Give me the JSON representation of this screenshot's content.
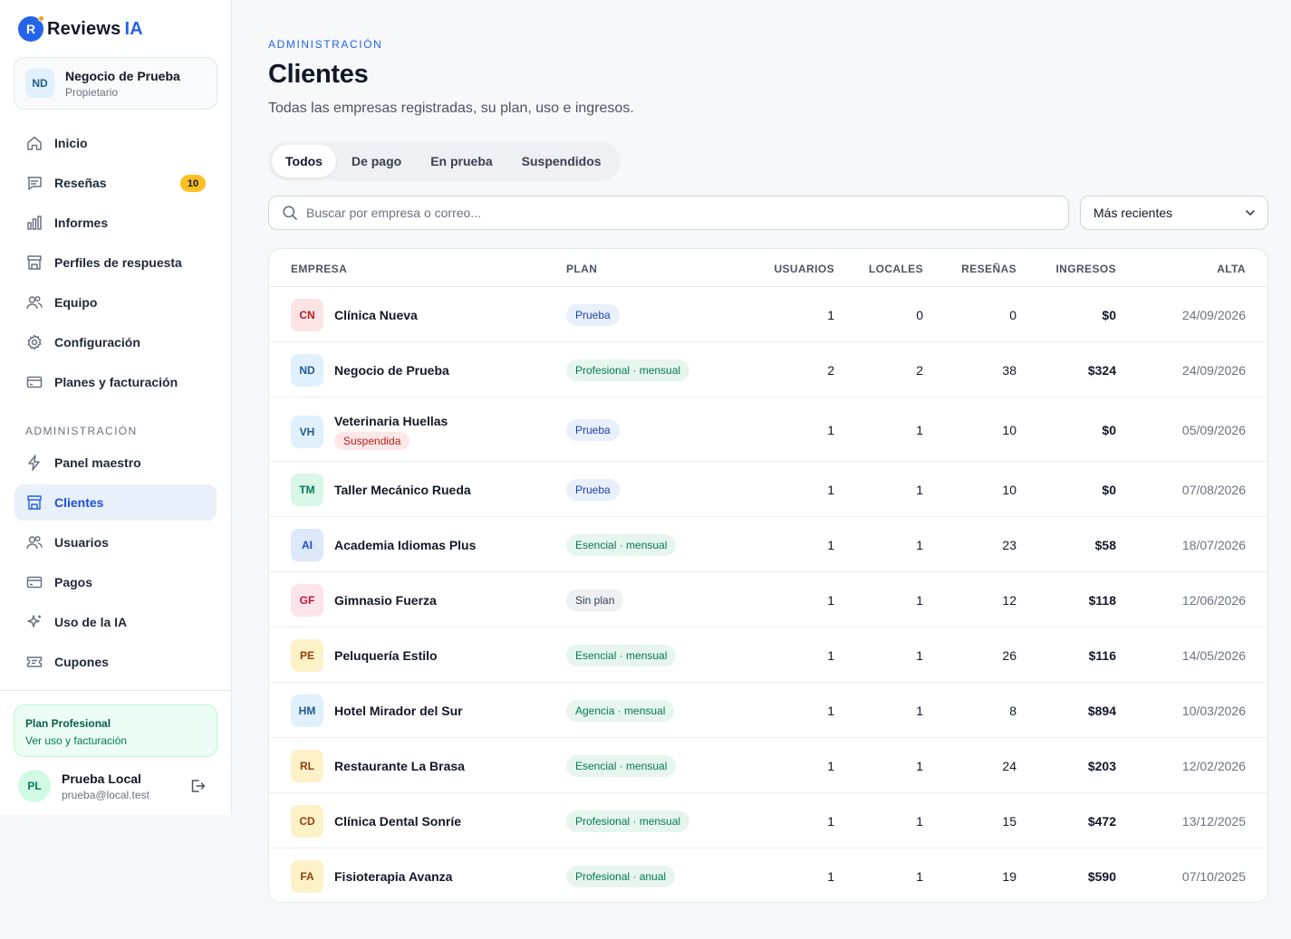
{
  "brand": {
    "logo_letter": "R",
    "name": "Reviews",
    "accent": "IA"
  },
  "business": {
    "initials": "ND",
    "name": "Negocio de Prueba",
    "role": "Propietario"
  },
  "nav": {
    "main": [
      {
        "label": "Inicio",
        "icon": "home-icon"
      },
      {
        "label": "Reseñas",
        "icon": "chat-icon",
        "badge": "10"
      },
      {
        "label": "Informes",
        "icon": "bar-chart-icon"
      },
      {
        "label": "Perfiles de respuesta",
        "icon": "store-icon"
      },
      {
        "label": "Equipo",
        "icon": "users-icon"
      },
      {
        "label": "Configuración",
        "icon": "gear-icon"
      },
      {
        "label": "Planes y facturación",
        "icon": "credit-card-icon"
      }
    ],
    "admin_section": "ADMINISTRACIÓN",
    "admin": [
      {
        "label": "Panel maestro",
        "icon": "bolt-icon"
      },
      {
        "label": "Clientes",
        "icon": "store-icon",
        "active": true
      },
      {
        "label": "Usuarios",
        "icon": "users-icon"
      },
      {
        "label": "Pagos",
        "icon": "credit-card-icon"
      },
      {
        "label": "Uso de la IA",
        "icon": "sparkle-icon"
      },
      {
        "label": "Cupones",
        "icon": "ticket-icon"
      }
    ]
  },
  "plan_card": {
    "title": "Plan Profesional",
    "link": "Ver uso y facturación"
  },
  "user": {
    "initials": "PL",
    "name": "Prueba Local",
    "email": "prueba@local.test"
  },
  "header": {
    "eyebrow": "ADMINISTRACIÓN",
    "title": "Clientes",
    "subtitle": "Todas las empresas registradas, su plan, uso e ingresos."
  },
  "tabs": [
    "Todos",
    "De pago",
    "En prueba",
    "Suspendidos"
  ],
  "search": {
    "placeholder": "Buscar por empresa o correo..."
  },
  "sort": {
    "selected": "Más recientes"
  },
  "table": {
    "columns": {
      "company": "EMPRESA",
      "plan": "PLAN",
      "users": "USUARIOS",
      "locations": "LOCALES",
      "reviews": "RESEÑAS",
      "revenue": "INGRESOS",
      "signup": "ALTA"
    },
    "rows": [
      {
        "initials": "CN",
        "company": "Clínica Nueva",
        "plan": "Prueba",
        "plan_kind": "trial",
        "users": "1",
        "locations": "0",
        "reviews": "0",
        "revenue": "$0",
        "signup": "24/09/2026",
        "color_bg": "#fde4e4",
        "color_fg": "#b91c1c"
      },
      {
        "initials": "ND",
        "company": "Negocio de Prueba",
        "plan": "Profesional · mensual",
        "plan_kind": "paid",
        "users": "2",
        "locations": "2",
        "reviews": "38",
        "revenue": "$324",
        "signup": "24/09/2026",
        "color_bg": "#e0f0fc",
        "color_fg": "#1e5a8a"
      },
      {
        "initials": "VH",
        "company": "Veterinaria Huellas",
        "status": "Suspendida",
        "plan": "Prueba",
        "plan_kind": "trial",
        "users": "1",
        "locations": "1",
        "reviews": "10",
        "revenue": "$0",
        "signup": "05/09/2026",
        "color_bg": "#e0f0fc",
        "color_fg": "#1e5a8a"
      },
      {
        "initials": "TM",
        "company": "Taller Mecánico Rueda",
        "plan": "Prueba",
        "plan_kind": "trial",
        "users": "1",
        "locations": "1",
        "reviews": "10",
        "revenue": "$0",
        "signup": "07/08/2026",
        "color_bg": "#d8f7e6",
        "color_fg": "#047857"
      },
      {
        "initials": "AI",
        "company": "Academia Idiomas Plus",
        "plan": "Esencial · mensual",
        "plan_kind": "paid",
        "users": "1",
        "locations": "1",
        "reviews": "23",
        "revenue": "$58",
        "signup": "18/07/2026",
        "color_bg": "#dde8fb",
        "color_fg": "#1d4ed8"
      },
      {
        "initials": "GF",
        "company": "Gimnasio Fuerza",
        "plan": "Sin plan",
        "plan_kind": "none",
        "users": "1",
        "locations": "1",
        "reviews": "12",
        "revenue": "$118",
        "signup": "12/06/2026",
        "color_bg": "#fce4e8",
        "color_fg": "#be123c"
      },
      {
        "initials": "PE",
        "company": "Peluquería Estilo",
        "plan": "Esencial · mensual",
        "plan_kind": "paid",
        "users": "1",
        "locations": "1",
        "reviews": "26",
        "revenue": "$116",
        "signup": "14/05/2026",
        "color_bg": "#fdf1c7",
        "color_fg": "#92400e"
      },
      {
        "initials": "HM",
        "company": "Hotel Mirador del Sur",
        "plan": "Agencia · mensual",
        "plan_kind": "paid",
        "users": "1",
        "locations": "1",
        "reviews": "8",
        "revenue": "$894",
        "signup": "10/03/2026",
        "color_bg": "#e0f0fc",
        "color_fg": "#1e5a8a"
      },
      {
        "initials": "RL",
        "company": "Restaurante La Brasa",
        "plan": "Esencial · mensual",
        "plan_kind": "paid",
        "users": "1",
        "locations": "1",
        "reviews": "24",
        "revenue": "$203",
        "signup": "12/02/2026",
        "color_bg": "#fdf1c7",
        "color_fg": "#92400e"
      },
      {
        "initials": "CD",
        "company": "Clínica Dental Sonríe",
        "plan": "Profesional · mensual",
        "plan_kind": "paid",
        "users": "1",
        "locations": "1",
        "reviews": "15",
        "revenue": "$472",
        "signup": "13/12/2025",
        "color_bg": "#fdf1c7",
        "color_fg": "#92400e"
      },
      {
        "initials": "FA",
        "company": "Fisioterapia Avanza",
        "plan": "Profesional · anual",
        "plan_kind": "paid",
        "users": "1",
        "locations": "1",
        "reviews": "19",
        "revenue": "$590",
        "signup": "07/10/2025",
        "color_bg": "#fdf1c7",
        "color_fg": "#92400e"
      }
    ]
  }
}
